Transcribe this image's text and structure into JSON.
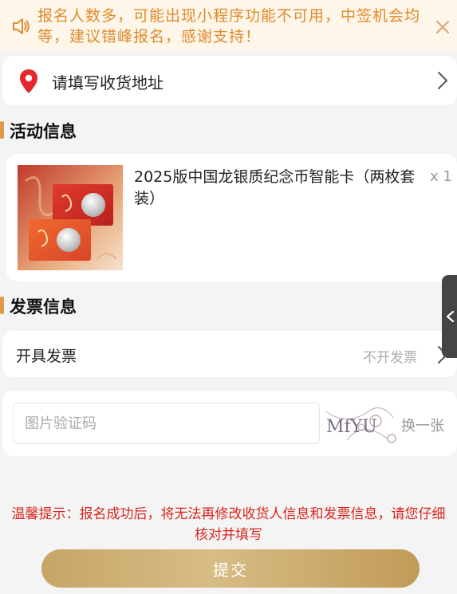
{
  "notice": {
    "text": "报名人数多，可能出现小程序功能不可用，中签机会均等，建议错峰报名，感谢支持！"
  },
  "address": {
    "placeholder": "请填写收货地址"
  },
  "activity_section": {
    "title": "活动信息"
  },
  "product": {
    "name": "2025版中国龙银质纪念币智能卡（两枚套装）",
    "quantity": "x 1"
  },
  "invoice_section": {
    "title": "发票信息",
    "row_label": "开具发票",
    "row_value": "不开发票"
  },
  "captcha": {
    "placeholder": "图片验证码",
    "image_text": "MfYU",
    "refresh_label": "换一张"
  },
  "tip": {
    "text": "温馨提示：报名成功后，将无法再修改收货人信息和发票信息，请您仔细核对并填写"
  },
  "submit": {
    "label": "提交"
  },
  "colors": {
    "accent_orange": "#e08a2c",
    "warning_red": "#d9261c",
    "gold_button": "#c7a567",
    "pin_red": "#e5262b"
  }
}
